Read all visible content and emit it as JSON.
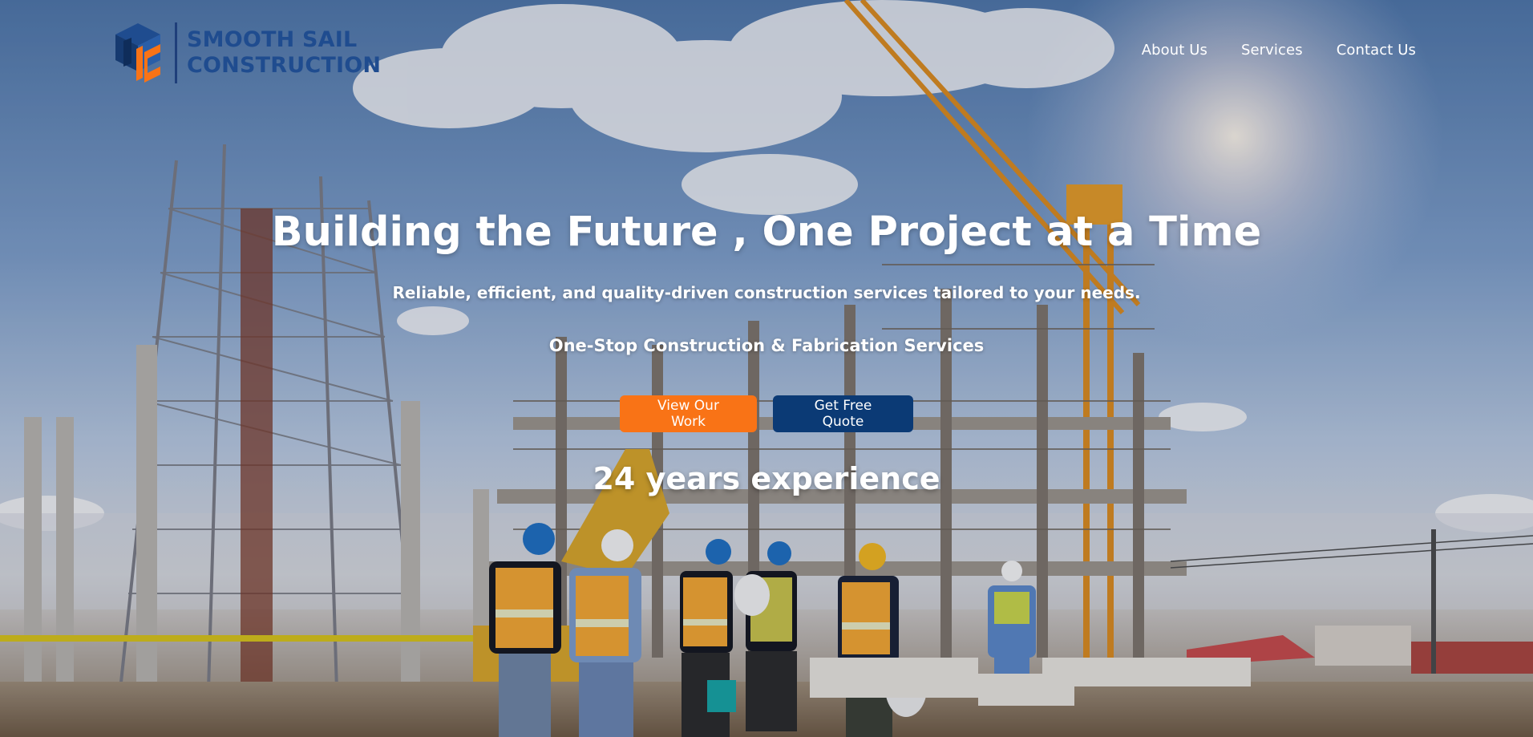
{
  "brand": {
    "name_line1": "SMOOTH SAIL",
    "name_line2": "CONSTRUCTION",
    "logo_icon": "isometric-cube-logo-icon",
    "primary_color": "#1f4c8f",
    "accent_color": "#f97316"
  },
  "nav": {
    "items": [
      {
        "label": "About Us"
      },
      {
        "label": "Services"
      },
      {
        "label": "Contact Us"
      }
    ]
  },
  "hero": {
    "headline": "Building the Future , One Project at a Time",
    "subtitle": "Reliable, efficient, and quality-driven construction services tailored to your needs.",
    "tagline": "One-Stop Construction & Fabrication Services",
    "cta_primary": "View Our Work",
    "cta_secondary": "Get Free Quote",
    "cta_primary_color": "#f97316",
    "cta_secondary_color": "#0b3a75",
    "experience": "24 years experience"
  }
}
